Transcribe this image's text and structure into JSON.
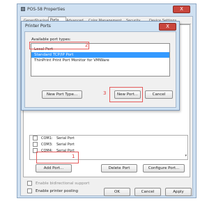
{
  "window": {
    "title": "POS-58 Properties",
    "close_label": "X",
    "tabs": [
      "General",
      "Sharing",
      "Ports",
      "Advanced",
      "Color Management",
      "Security",
      "Device Settings"
    ],
    "ports": [
      {
        "name": "COM1:",
        "desc": "Serial Port"
      },
      {
        "name": "COM3:",
        "desc": "Serial Port"
      },
      {
        "name": "COM4:",
        "desc": "Serial Port"
      }
    ],
    "add_port": "Add Port...",
    "delete_port": "Delete Port",
    "configure_port": "Configure Port...",
    "bidirectional": "Enable bidirectional support",
    "pooling": "Enable printer pooling",
    "ok": "OK",
    "cancel": "Cancel",
    "apply": "Apply"
  },
  "dialog": {
    "title": "Printer Ports",
    "available_label": "Available port types:",
    "port_types": [
      "Local Port",
      "Standard TCP/IP Port",
      "ThinPrint Print Port Monitor for VMWare"
    ],
    "selected_index": 1,
    "new_port_type": "New Port Type...",
    "new_port": "New Port...",
    "cancel": "Cancel"
  },
  "annotations": {
    "step1": "1",
    "step2": "2",
    "step3": "3"
  },
  "colors": {
    "highlight": "#e45b5b",
    "selection": "#3399ff",
    "title_bg": "#cfe0f1"
  }
}
